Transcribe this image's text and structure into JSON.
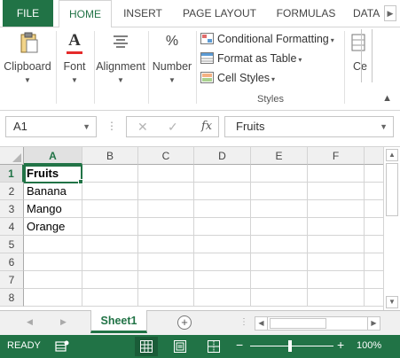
{
  "ribbon_tabs": {
    "file": "FILE",
    "home": "HOME",
    "insert": "INSERT",
    "page_layout": "PAGE LAYOUT",
    "formulas": "FORMULAS",
    "data": "DATA"
  },
  "ribbon": {
    "clipboard": "Clipboard",
    "font": "Font",
    "alignment": "Alignment",
    "number": "Number",
    "number_icon": "%",
    "font_icon": "A",
    "conditional_formatting": "Conditional Formatting",
    "format_as_table": "Format as Table",
    "cell_styles": "Cell Styles",
    "styles_group": "Styles",
    "cells_partial": "Ce"
  },
  "formula_bar": {
    "name_box": "A1",
    "fx": "fx",
    "content": "Fruits"
  },
  "grid": {
    "columns": [
      "A",
      "B",
      "C",
      "D",
      "E",
      "F"
    ],
    "rows": [
      "1",
      "2",
      "3",
      "4",
      "5",
      "6",
      "7",
      "8"
    ],
    "cells_a": [
      "Fruits",
      "Banana",
      "Mango",
      "Orange",
      "",
      "",
      "",
      ""
    ]
  },
  "sheets": {
    "active": "Sheet1",
    "add": "+"
  },
  "status": {
    "ready": "READY",
    "zoom": "100%",
    "zoom_minus": "−",
    "zoom_plus": "+"
  },
  "colors": {
    "accent": "#217346",
    "header_bg": "#f0f0f0",
    "gridline": "#d4d4d4"
  }
}
